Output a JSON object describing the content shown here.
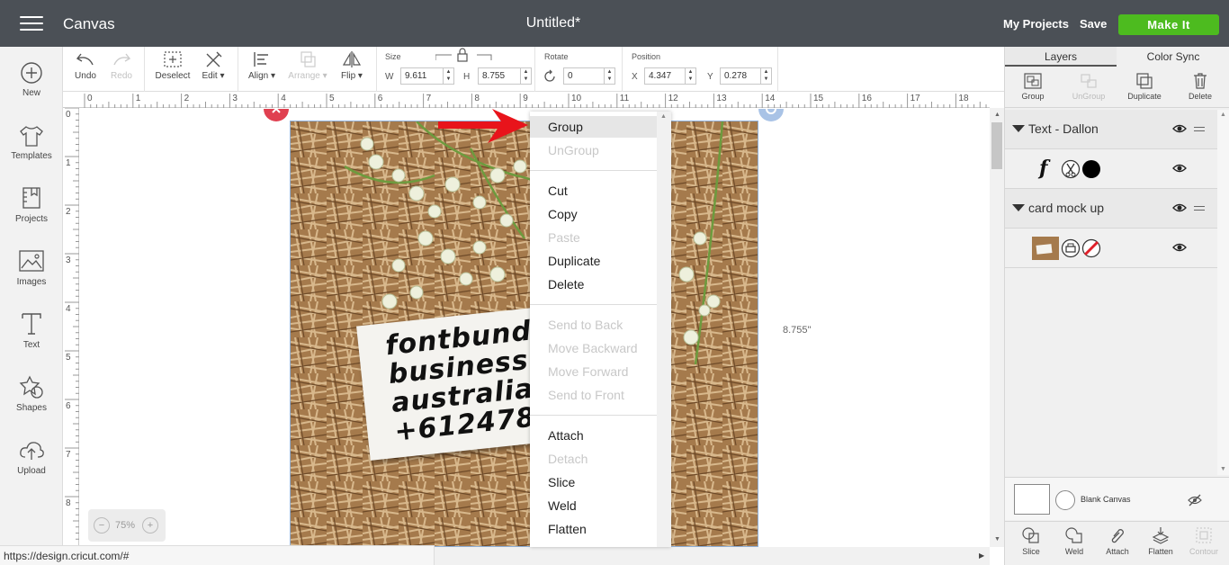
{
  "app": {
    "title": "Canvas",
    "document_title": "Untitled*"
  },
  "header": {
    "my_projects": "My Projects",
    "save": "Save",
    "make_it": "Make It",
    "make_it_color": "#4dbb1f",
    "bar_color": "#4b5056"
  },
  "sidebar": {
    "items": [
      {
        "label": "New",
        "icon": "plus-circle-icon"
      },
      {
        "label": "Templates",
        "icon": "shirt-icon"
      },
      {
        "label": "Projects",
        "icon": "projects-icon"
      },
      {
        "label": "Images",
        "icon": "image-icon"
      },
      {
        "label": "Text",
        "icon": "text-icon"
      },
      {
        "label": "Shapes",
        "icon": "shapes-icon"
      },
      {
        "label": "Upload",
        "icon": "upload-icon"
      }
    ]
  },
  "toolbar": {
    "undo": "Undo",
    "redo": "Redo",
    "deselect": "Deselect",
    "edit": "Edit",
    "align": "Align",
    "arrange": "Arrange",
    "flip": "Flip",
    "size_label": "Size",
    "w_label": "W",
    "w_value": "9.611",
    "h_label": "H",
    "h_value": "8.755",
    "rotate_label": "Rotate",
    "rotate_value": "0",
    "position_label": "Position",
    "x_label": "X",
    "x_value": "4.347",
    "y_label": "Y",
    "y_value": "0.278"
  },
  "rulers": {
    "horizontal": [
      "0",
      "1",
      "2",
      "3",
      "4",
      "5",
      "6",
      "7",
      "8",
      "9",
      "10",
      "11",
      "12",
      "13",
      "14",
      "15",
      "16",
      "17",
      "18"
    ],
    "vertical": [
      "0",
      "1",
      "2",
      "3",
      "4",
      "5",
      "6",
      "7",
      "8"
    ]
  },
  "canvas": {
    "dimension_label": "8.755\"",
    "card_text": "fontbundl\nbusiness p\naustralia\n+6124789261",
    "zoom": "75%",
    "zoom_minus": "−",
    "zoom_plus": "+"
  },
  "context_menu": {
    "groups": [
      [
        {
          "label": "Group",
          "enabled": true,
          "hover": true
        },
        {
          "label": "UnGroup",
          "enabled": false
        }
      ],
      [
        {
          "label": "Cut",
          "enabled": true
        },
        {
          "label": "Copy",
          "enabled": true
        },
        {
          "label": "Paste",
          "enabled": false
        },
        {
          "label": "Duplicate",
          "enabled": true
        },
        {
          "label": "Delete",
          "enabled": true
        }
      ],
      [
        {
          "label": "Send to Back",
          "enabled": false
        },
        {
          "label": "Move Backward",
          "enabled": false
        },
        {
          "label": "Move Forward",
          "enabled": false
        },
        {
          "label": "Send to Front",
          "enabled": false
        }
      ],
      [
        {
          "label": "Attach",
          "enabled": true
        },
        {
          "label": "Detach",
          "enabled": false
        },
        {
          "label": "Slice",
          "enabled": true
        },
        {
          "label": "Weld",
          "enabled": true
        },
        {
          "label": "Flatten",
          "enabled": true
        }
      ]
    ]
  },
  "right_panel": {
    "tabs": [
      {
        "label": "Layers",
        "active": true
      },
      {
        "label": "Color Sync",
        "active": false
      }
    ],
    "layer_tools": [
      {
        "label": "Group",
        "enabled": true
      },
      {
        "label": "UnGroup",
        "enabled": false
      },
      {
        "label": "Duplicate",
        "enabled": true
      },
      {
        "label": "Delete",
        "enabled": true
      }
    ],
    "layers": [
      {
        "name": "Text - Dallon"
      },
      {
        "name": "card mock up"
      }
    ],
    "blank_canvas": "Blank Canvas",
    "bottom_tools": [
      {
        "label": "Slice",
        "enabled": true
      },
      {
        "label": "Weld",
        "enabled": true
      },
      {
        "label": "Attach",
        "enabled": true
      },
      {
        "label": "Flatten",
        "enabled": true
      },
      {
        "label": "Contour",
        "enabled": false
      }
    ]
  },
  "status_bar": {
    "url": "https://design.cricut.com/#"
  }
}
